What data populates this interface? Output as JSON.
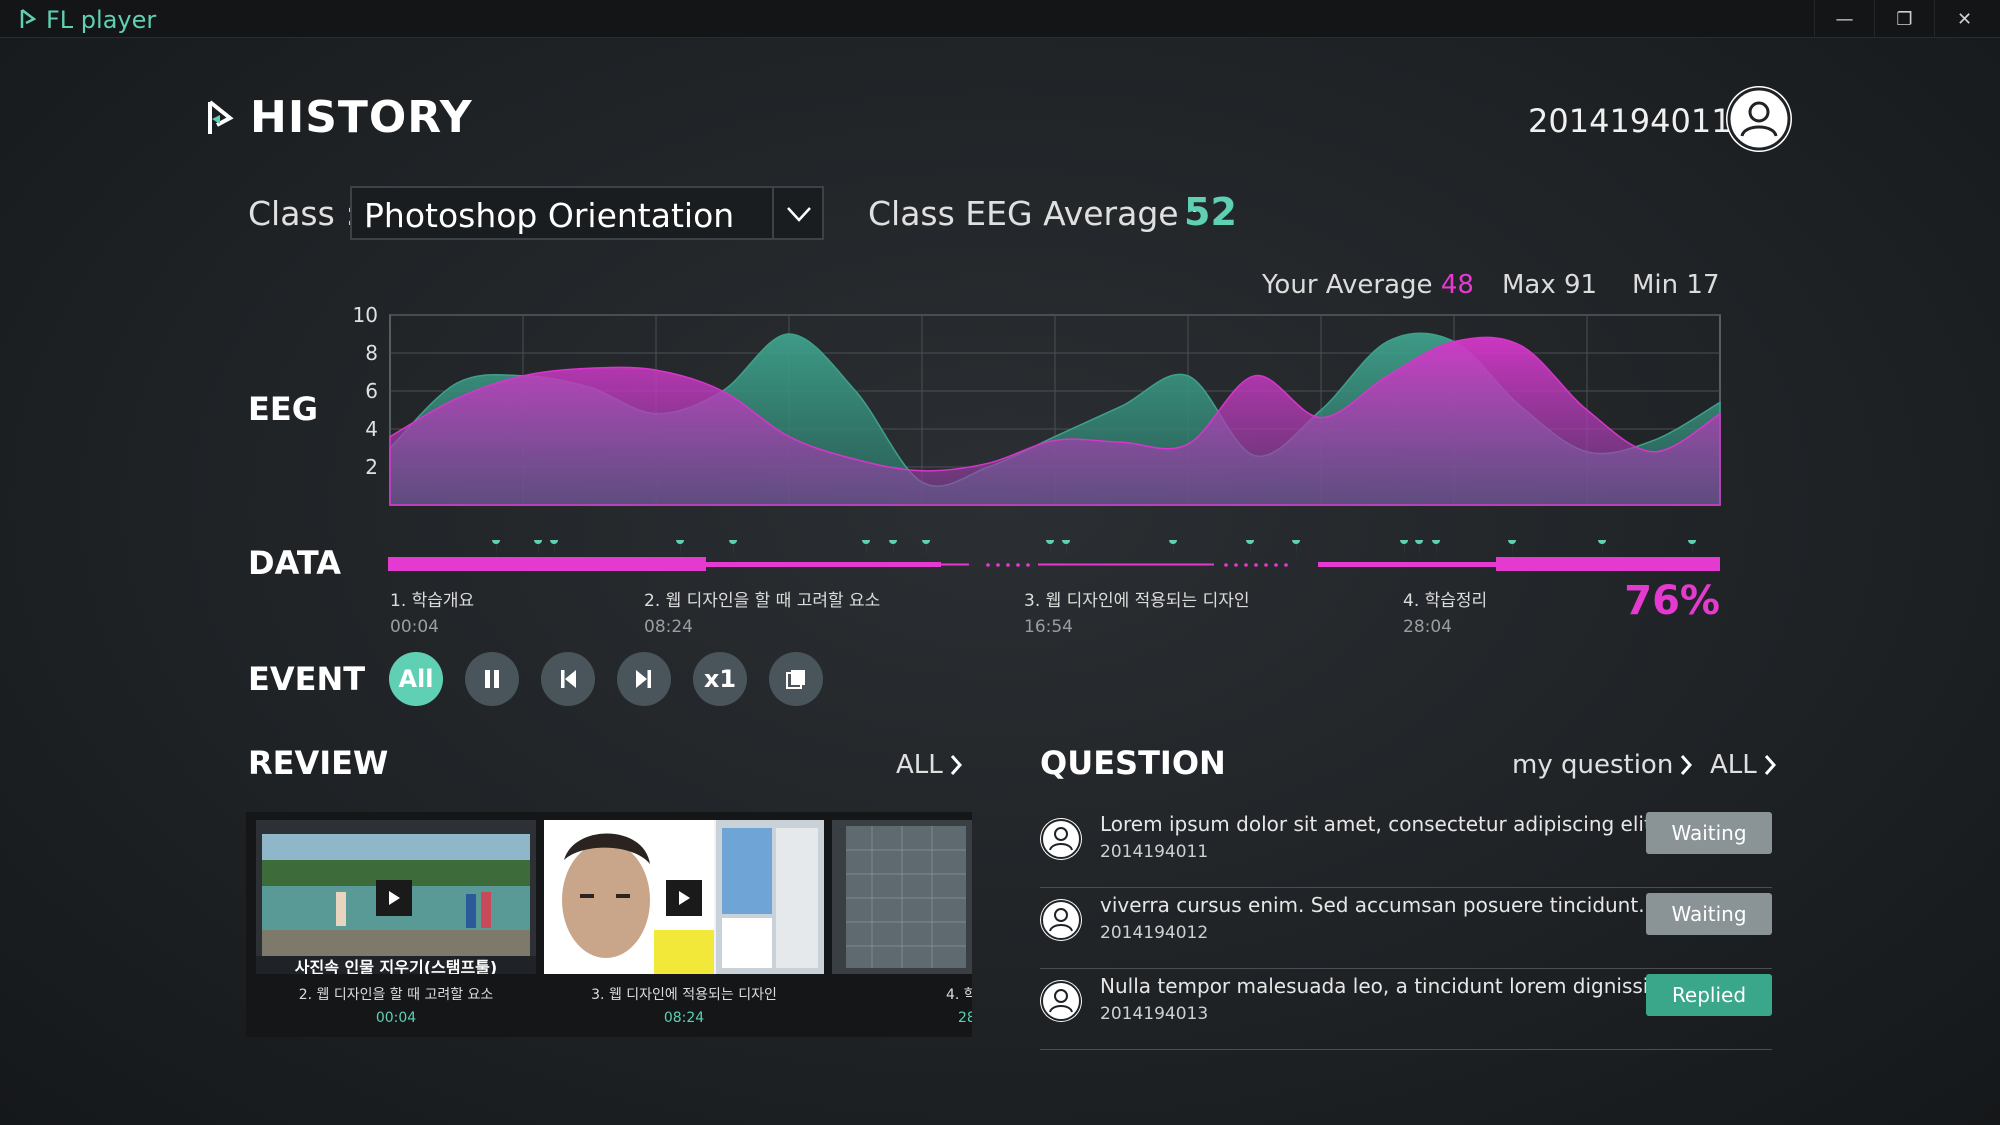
{
  "window": {
    "title": "FL player",
    "controls": {
      "minimize": "—",
      "restore": "❐",
      "close": "✕"
    }
  },
  "header": {
    "title": "HISTORY",
    "user_id": "2014194011"
  },
  "class_row": {
    "label": "Class :",
    "selected": "Photoshop Orientation",
    "avg_label": "Class EEG Average :",
    "avg_value": "52"
  },
  "stats": {
    "your_avg_label": "Your Average",
    "your_avg_value": "48",
    "max_label": "Max 91",
    "min_label": "Min 17"
  },
  "eeg": {
    "label": "EEG"
  },
  "chart_data": {
    "type": "area",
    "ylim": [
      0,
      10
    ],
    "yticks": [
      2,
      4,
      6,
      8,
      10
    ],
    "x": [
      0,
      5,
      10,
      15,
      20,
      25,
      30,
      35,
      40,
      45,
      50,
      55,
      60,
      65,
      70,
      75,
      80,
      85,
      90,
      95,
      100
    ],
    "series": [
      {
        "color": "#3fa08b",
        "values": [
          3.0,
          6.4,
          6.8,
          6.2,
          4.8,
          6.0,
          9.0,
          6.0,
          1.2,
          2.0,
          3.6,
          5.2,
          6.8,
          2.6,
          5.0,
          8.6,
          8.6,
          5.2,
          2.8,
          3.4,
          5.4
        ]
      },
      {
        "color": "#d537c9",
        "values": [
          3.6,
          5.6,
          6.8,
          7.2,
          7.1,
          6.0,
          3.6,
          2.4,
          1.8,
          2.2,
          3.4,
          3.3,
          3.2,
          6.8,
          4.6,
          6.8,
          8.6,
          8.4,
          5.0,
          2.8,
          4.8
        ]
      }
    ]
  },
  "data": {
    "label": "DATA",
    "progress": "76%",
    "progress_fraction": 0.76,
    "chapters": [
      {
        "title": "1. 학습개요",
        "time": "00:04"
      },
      {
        "title": "2. 웹 디자인을 할 때 고려할 요소",
        "time": "08:24"
      },
      {
        "title": "3. 웹 디자인에 적용되는 디자인",
        "time": "16:54"
      },
      {
        "title": "4. 학습정리",
        "time": "28:04"
      }
    ]
  },
  "event": {
    "label": "EVENT",
    "buttons": [
      "All",
      "pause",
      "prev",
      "next",
      "x1",
      "copy"
    ],
    "all_label": "All",
    "speed_label": "x1"
  },
  "review": {
    "label": "REVIEW",
    "all_link": "ALL",
    "items": [
      {
        "overlay": "사진속 인물 지우기(스탬프툴)",
        "caption": "2. 웹 디자인을 할 때 고려할 요소",
        "time": "00:04"
      },
      {
        "caption": "3. 웹 디자인에 적용되는 디자인",
        "time": "08:24"
      },
      {
        "caption": "4. 학",
        "time": "28"
      }
    ]
  },
  "question": {
    "label": "QUESTION",
    "my_link": "my question",
    "all_link": "ALL",
    "items": [
      {
        "text": "Lorem ipsum dolor sit amet, consectetur adipiscing elit...",
        "user": "2014194011",
        "status": "Waiting"
      },
      {
        "text": "viverra cursus enim. Sed accumsan posuere tincidunt....",
        "user": "2014194012",
        "status": "Waiting"
      },
      {
        "text": "Nulla tempor malesuada leo, a tincidunt lorem dignissim ...",
        "user": "2014194013",
        "status": "Replied"
      }
    ]
  },
  "colors": {
    "accent_teal": "#5fd0b3",
    "accent_magenta": "#e53ad0",
    "background": "#1f2326"
  },
  "icons": [
    "play-logo-icon",
    "user-icon",
    "chevron-down-icon",
    "chevron-right-icon",
    "pause-icon",
    "skip-back-icon",
    "skip-forward-icon",
    "copy-icon",
    "play-icon",
    "marker-pin-icon"
  ]
}
